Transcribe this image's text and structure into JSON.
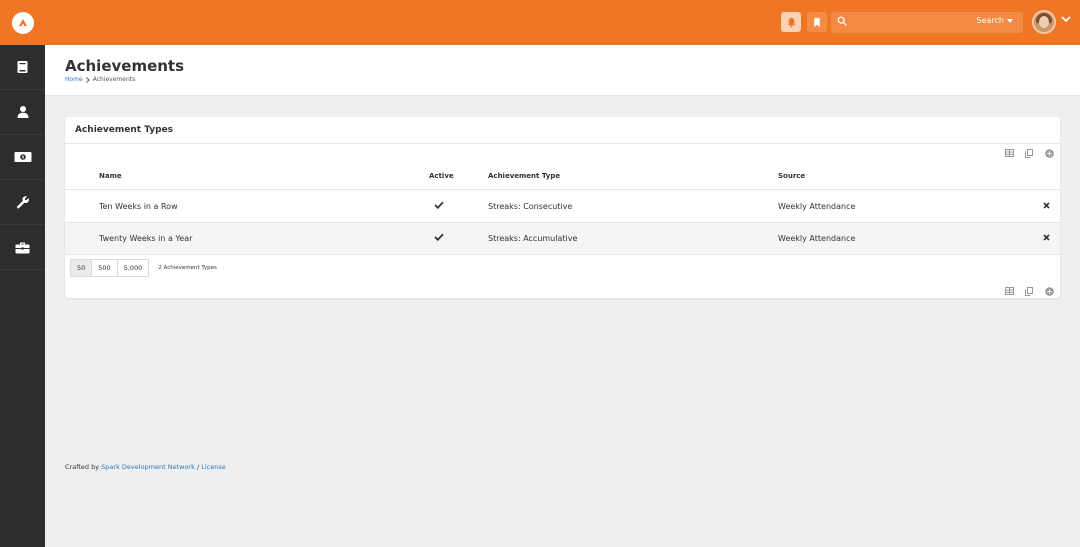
{
  "colors": {
    "brand_orange": "#ee7625",
    "sidebar_bg": "#2d2d2d",
    "link_blue": "#2a76c6"
  },
  "topbar": {
    "logo": "rock-logo-icon",
    "notifications_icon": "bell-icon",
    "bookmark_icon": "bookmark-icon",
    "search": {
      "placeholder": "",
      "button_label": "Search"
    }
  },
  "sidebar": {
    "items": [
      {
        "icon": "book-icon"
      },
      {
        "icon": "person-icon"
      },
      {
        "icon": "money-icon"
      },
      {
        "icon": "wrench-icon"
      },
      {
        "icon": "briefcase-icon"
      }
    ]
  },
  "page": {
    "title": "Achievements",
    "breadcrumb": {
      "home": "Home",
      "current": "Achievements"
    }
  },
  "panel": {
    "title": "Achievement Types",
    "columns": {
      "name": "Name",
      "active": "Active",
      "type": "Achievement Type",
      "source": "Source"
    },
    "rows": [
      {
        "name": "Ten Weeks in a Row",
        "active": true,
        "type": "Streaks: Consecutive",
        "source": "Weekly Attendance"
      },
      {
        "name": "Twenty Weeks in a Year",
        "active": true,
        "type": "Streaks: Accumulative",
        "source": "Weekly Attendance"
      }
    ],
    "page_sizes": [
      "50",
      "500",
      "5,000"
    ],
    "item_count": "2 Achievement Types"
  },
  "footer": {
    "prefix": "Crafted by",
    "link": "Spark Development Network",
    "separator": "/",
    "license": "License"
  }
}
